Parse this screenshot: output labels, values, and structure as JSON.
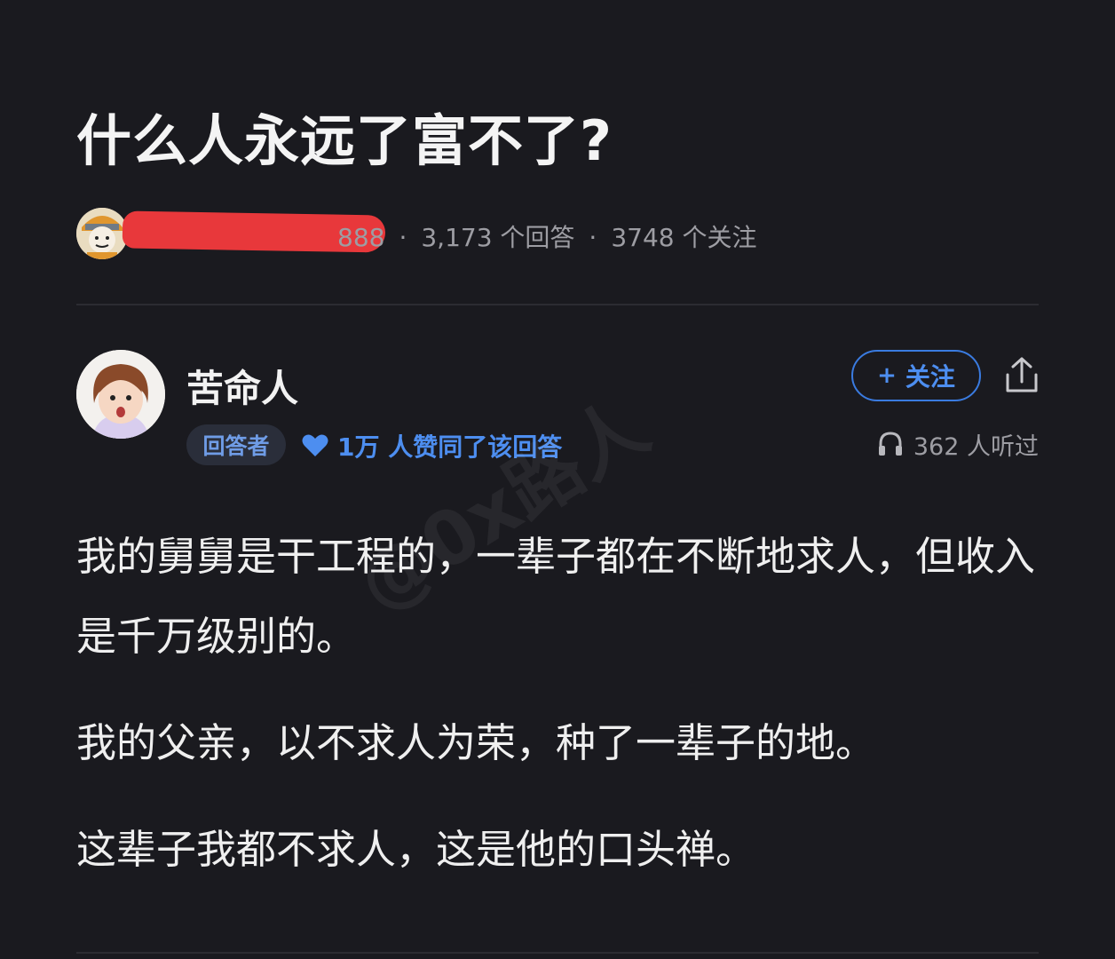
{
  "question": {
    "title": "什么人永远了富不了?"
  },
  "asker": {
    "stat_partial": "888",
    "separator": "·",
    "answers_count": "3,173 个回答",
    "followers_count": "3748 个关注"
  },
  "answer": {
    "author_name": "苦命人",
    "follow_label": "关注",
    "follow_plus": "+",
    "role_badge": "回答者",
    "likes_text": "1万 人赞同了该回答",
    "listen_text": "362 人听过",
    "paragraphs": [
      "我的舅舅是干工程的，一辈子都在不断地求人，但收入是千万级别的。",
      "我的父亲，以不求人为荣，种了一辈子的地。",
      "这辈子我都不求人，这是他的口头禅。"
    ]
  },
  "watermark": {
    "text": "@0x路人"
  },
  "colors": {
    "background": "#1a1a1f",
    "accent": "#4d8ef0",
    "redaction": "#e8383b",
    "muted": "#9d9da3"
  },
  "icons": {
    "heart": "heart-icon",
    "headphones": "headphones-icon",
    "share": "share-icon"
  }
}
